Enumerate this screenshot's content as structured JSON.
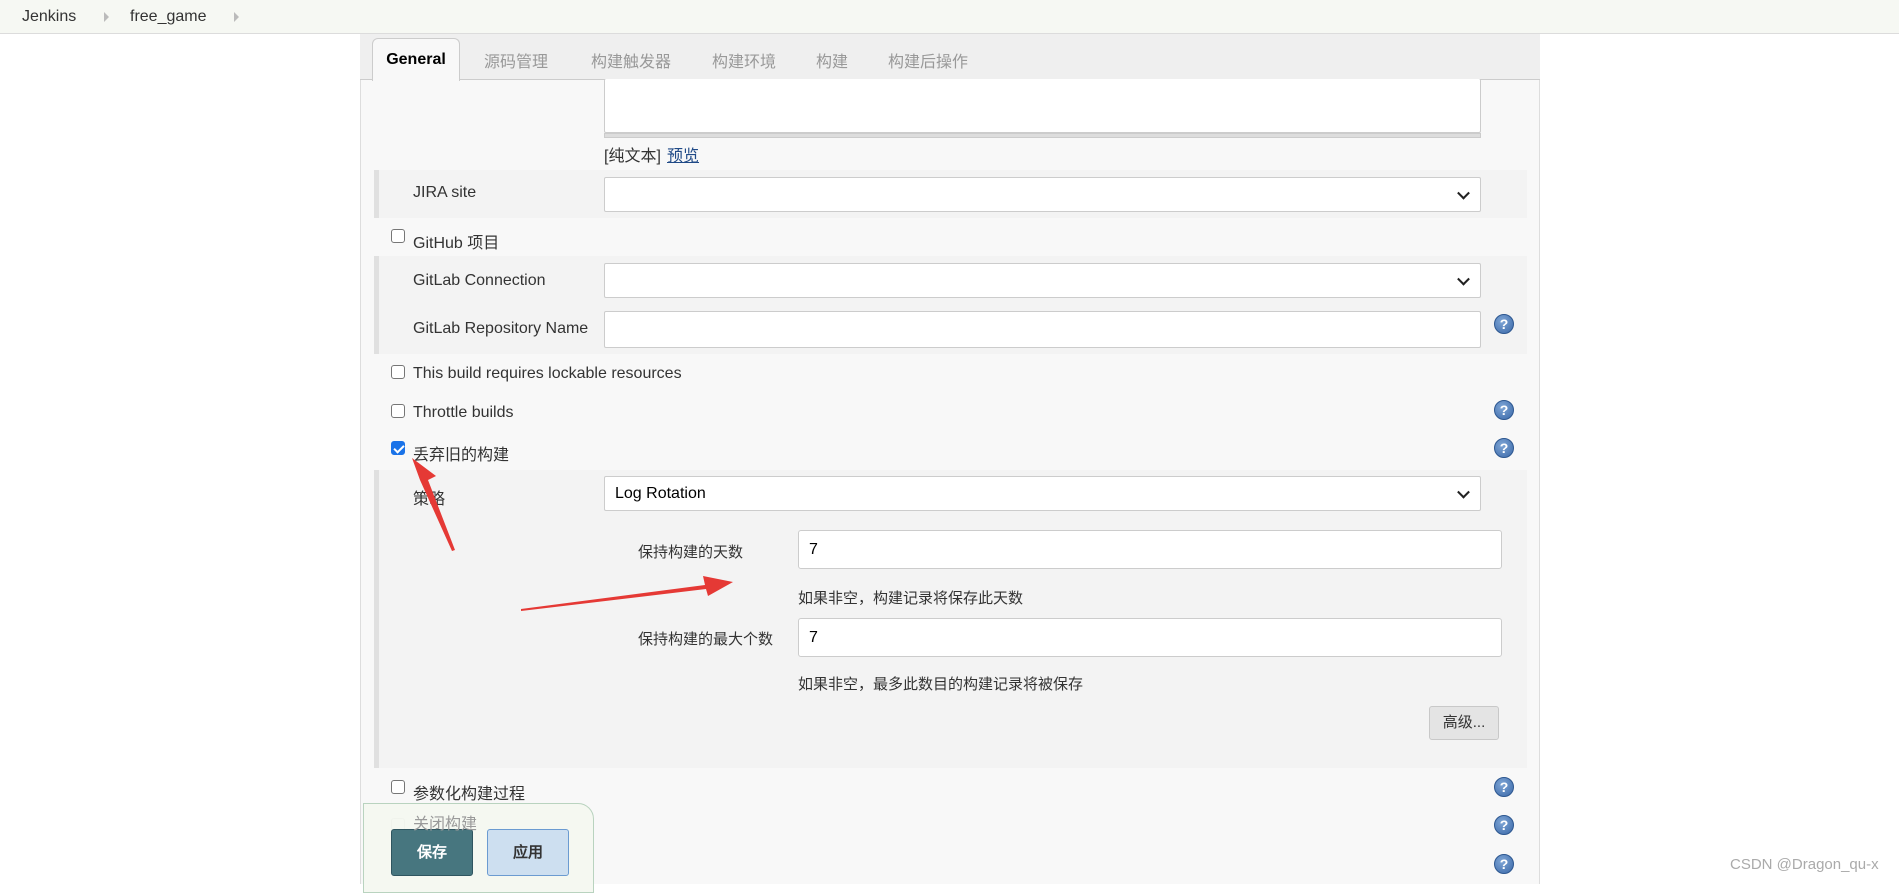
{
  "breadcrumb": {
    "items": [
      "Jenkins",
      "free_game"
    ]
  },
  "tabs": [
    "General",
    "源码管理",
    "构建触发器",
    "构建环境",
    "构建",
    "构建后操作"
  ],
  "description": {
    "plain_text": "[纯文本]",
    "preview_link": "预览"
  },
  "jira": {
    "label": "JIRA site",
    "value": ""
  },
  "github": {
    "label": "GitHub 项目",
    "checked": false
  },
  "gitlab": {
    "connection_label": "GitLab Connection",
    "connection_value": "",
    "repo_label": "GitLab Repository Name",
    "repo_value": ""
  },
  "options": {
    "lockable": {
      "label": "This build requires lockable resources",
      "checked": false
    },
    "throttle": {
      "label": "Throttle builds",
      "checked": false
    },
    "discard": {
      "label": "丢弃旧的构建",
      "checked": true
    },
    "parameterized": {
      "label": "参数化构建过程",
      "checked": false
    },
    "disable": {
      "label": "关闭构建",
      "checked": false
    }
  },
  "discard_settings": {
    "strategy_label": "策略",
    "strategy_value": "Log Rotation",
    "days_label": "保持构建的天数",
    "days_value": "7",
    "days_help": "如果非空，构建记录将保存此天数",
    "max_label": "保持构建的最大个数",
    "max_value": "7",
    "max_help": "如果非空，最多此数目的构建记录将被保存",
    "advanced_button": "高级..."
  },
  "footer": {
    "save": "保存",
    "apply": "应用"
  },
  "watermark": "CSDN @Dragon_qu-x",
  "colors": {
    "save_bg": "#47767f",
    "apply_bg": "#cddff0",
    "annotation_arrow": "#e53935",
    "checkbox_checked": "#1a73e8"
  }
}
